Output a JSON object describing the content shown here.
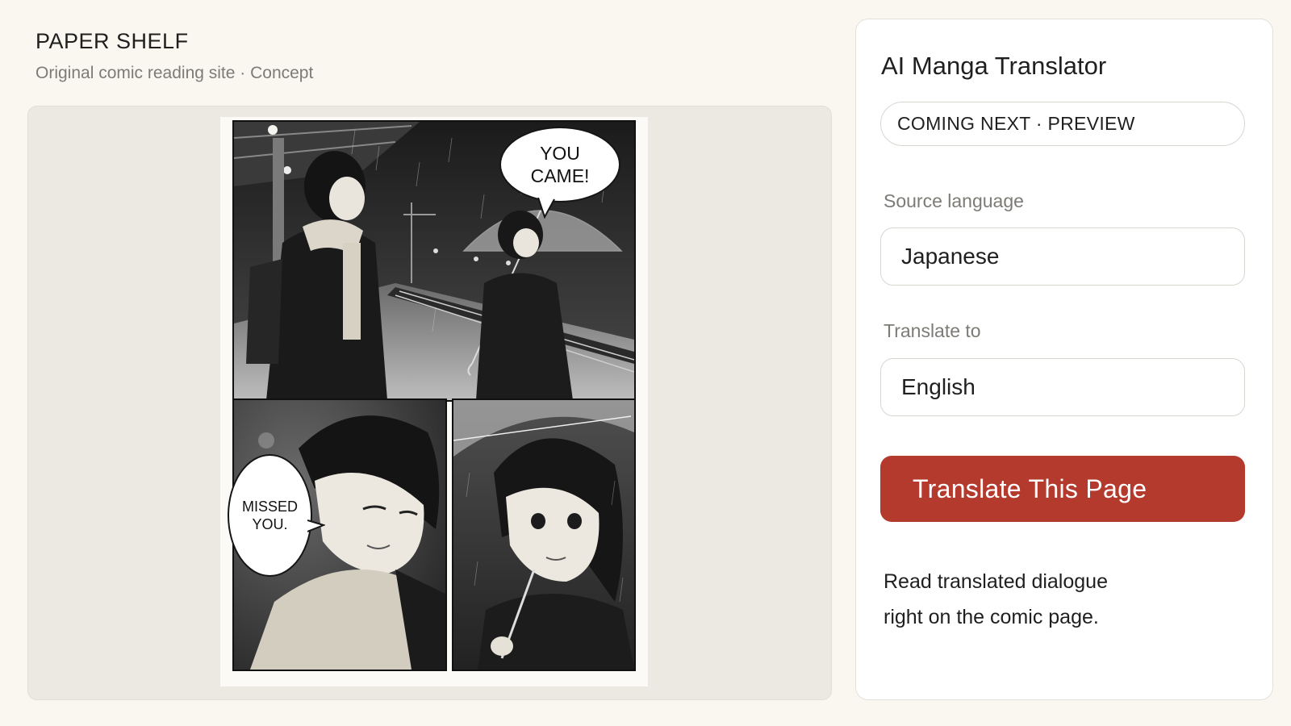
{
  "brand": {
    "title": "PAPER SHELF",
    "subtitle": "Original comic reading site · Concept"
  },
  "comic": {
    "bubbles": [
      {
        "text": "YOU\nCAME!"
      },
      {
        "text": "MISSED\nYOU."
      }
    ]
  },
  "translator": {
    "title": "AI Manga Translator",
    "badge": "COMING NEXT · PREVIEW",
    "source_label": "Source language",
    "source_value": "Japanese",
    "target_label": "Translate to",
    "target_value": "English",
    "button_label": "Translate This Page",
    "description_line1": "Read translated dialogue",
    "description_line2": "right on the comic page."
  },
  "colors": {
    "accent": "#b43a2e",
    "background": "#faf7f1",
    "viewer_bg": "#ece9e3"
  }
}
